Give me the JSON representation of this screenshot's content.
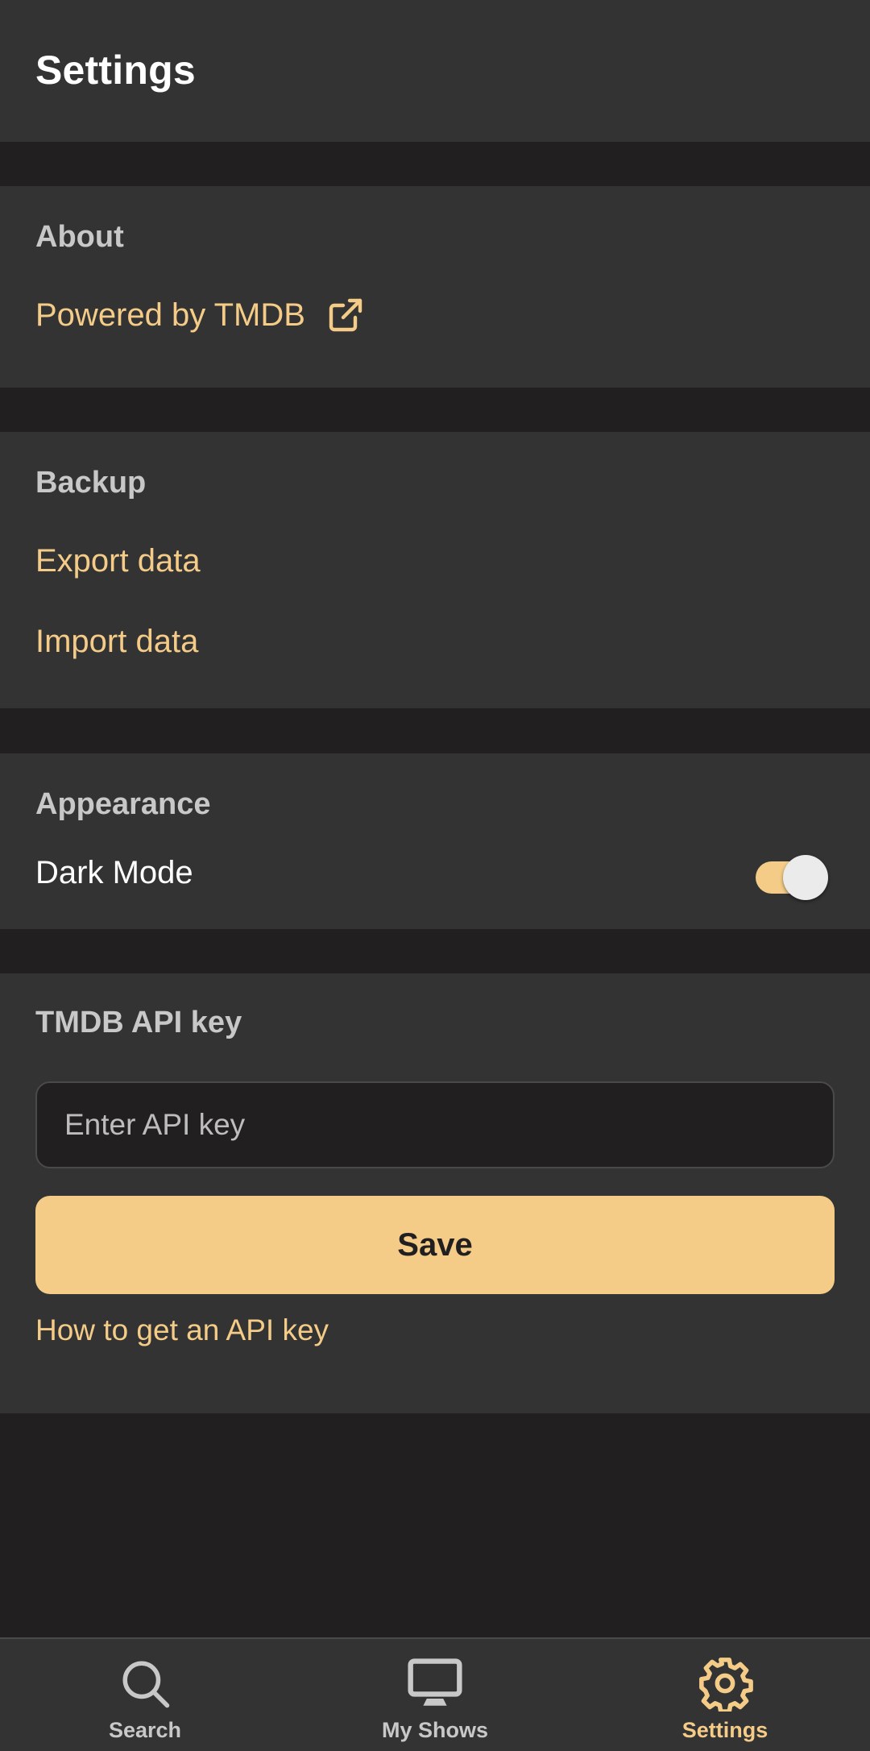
{
  "header": {
    "title": "Settings"
  },
  "about": {
    "title": "About",
    "powered_by": "Powered by TMDB",
    "external_icon": "external-link-icon"
  },
  "backup": {
    "title": "Backup",
    "export_label": "Export data",
    "import_label": "Import data"
  },
  "appearance": {
    "title": "Appearance",
    "dark_mode_label": "Dark Mode",
    "dark_mode_enabled": true
  },
  "api": {
    "title": "TMDB API key",
    "input_value": "",
    "input_placeholder": "Enter API key",
    "save_label": "Save",
    "help_link": "How to get an API key"
  },
  "nav": {
    "items": [
      {
        "label": "Search",
        "icon": "search-icon",
        "active": false
      },
      {
        "label": "My Shows",
        "icon": "monitor-icon",
        "active": false
      },
      {
        "label": "Settings",
        "icon": "gear-icon",
        "active": true
      }
    ]
  },
  "colors": {
    "background": "#221f20",
    "surface": "#333333",
    "accent": "#f4cc88",
    "section_title": "#c8c8c8",
    "text": "#ffffff"
  }
}
